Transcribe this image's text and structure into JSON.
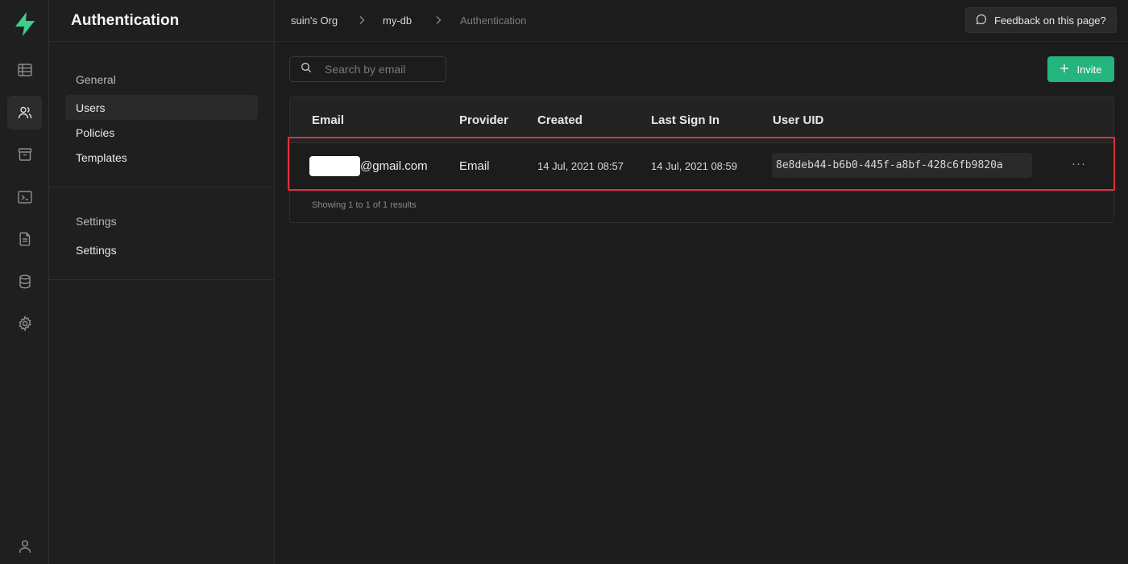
{
  "menu": {
    "title": "Authentication",
    "sections": [
      {
        "heading": "General",
        "items": [
          "Users",
          "Policies",
          "Templates"
        ]
      },
      {
        "heading": "Settings",
        "items": [
          "Settings"
        ]
      }
    ]
  },
  "breadcrumb": [
    "suin's Org",
    "my-db",
    "Authentication"
  ],
  "feedback_label": "Feedback on this page?",
  "search": {
    "placeholder": "Search by email"
  },
  "invite_label": "Invite",
  "table": {
    "columns": [
      "Email",
      "Provider",
      "Created",
      "Last Sign In",
      "User UID"
    ],
    "rows": [
      {
        "email_suffix": "@gmail.com",
        "provider": "Email",
        "created": "14 Jul, 2021 08:57",
        "last_sign_in": "14 Jul, 2021 08:59",
        "uid": "8e8deb44-b6b0-445f-a8bf-428c6fb9820a",
        "actions": "···"
      }
    ],
    "footer": "Showing 1 to 1 of 1 results"
  },
  "colors": {
    "accent": "#24b47e",
    "highlight": "#e0303e",
    "background": "#1c1c1c"
  },
  "icons": [
    "supabase-logo-icon",
    "table-editor-icon",
    "users-icon",
    "storage-icon",
    "sql-terminal-icon",
    "api-docs-icon",
    "database-icon",
    "settings-gear-icon",
    "profile-icon"
  ]
}
